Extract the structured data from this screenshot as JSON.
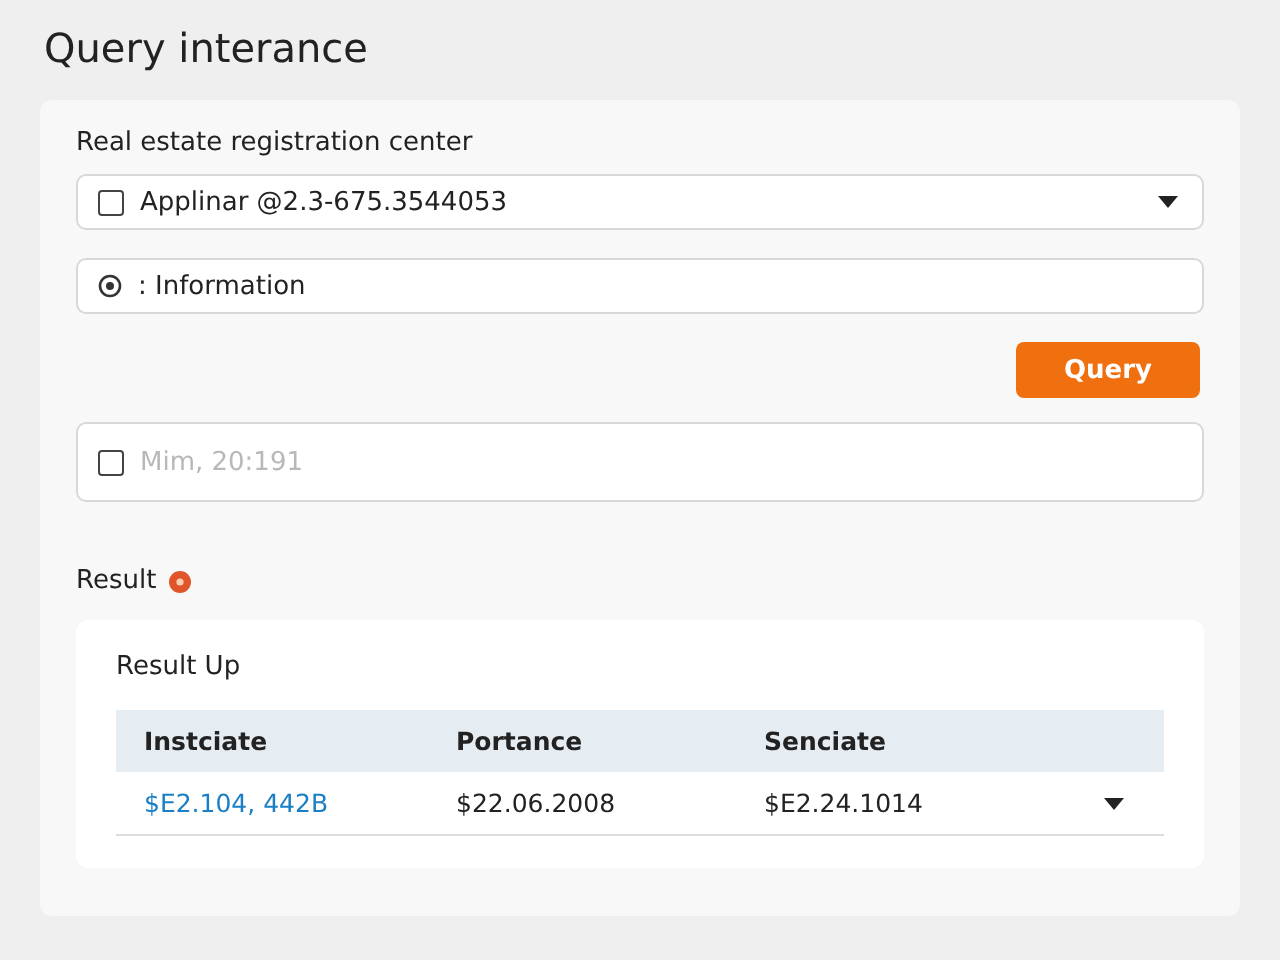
{
  "title": "Query interance",
  "form": {
    "label": "Real estate registration center",
    "select": {
      "value": "Applinar @2.3-675.3544053",
      "checked": false
    },
    "info_field": {
      "value": ": Information"
    },
    "button": "Query",
    "time_field": {
      "placeholder": "Mim, 20:191",
      "checked": false
    }
  },
  "result": {
    "label": "Result",
    "panel_title": "Result Up",
    "columns": [
      "Instciate",
      "Portance",
      "Senciate"
    ],
    "rows": [
      {
        "cells": [
          "$E2.104, 442B",
          "$22.06.2008",
          "$E2.24.1014"
        ],
        "expanded": false
      }
    ]
  }
}
